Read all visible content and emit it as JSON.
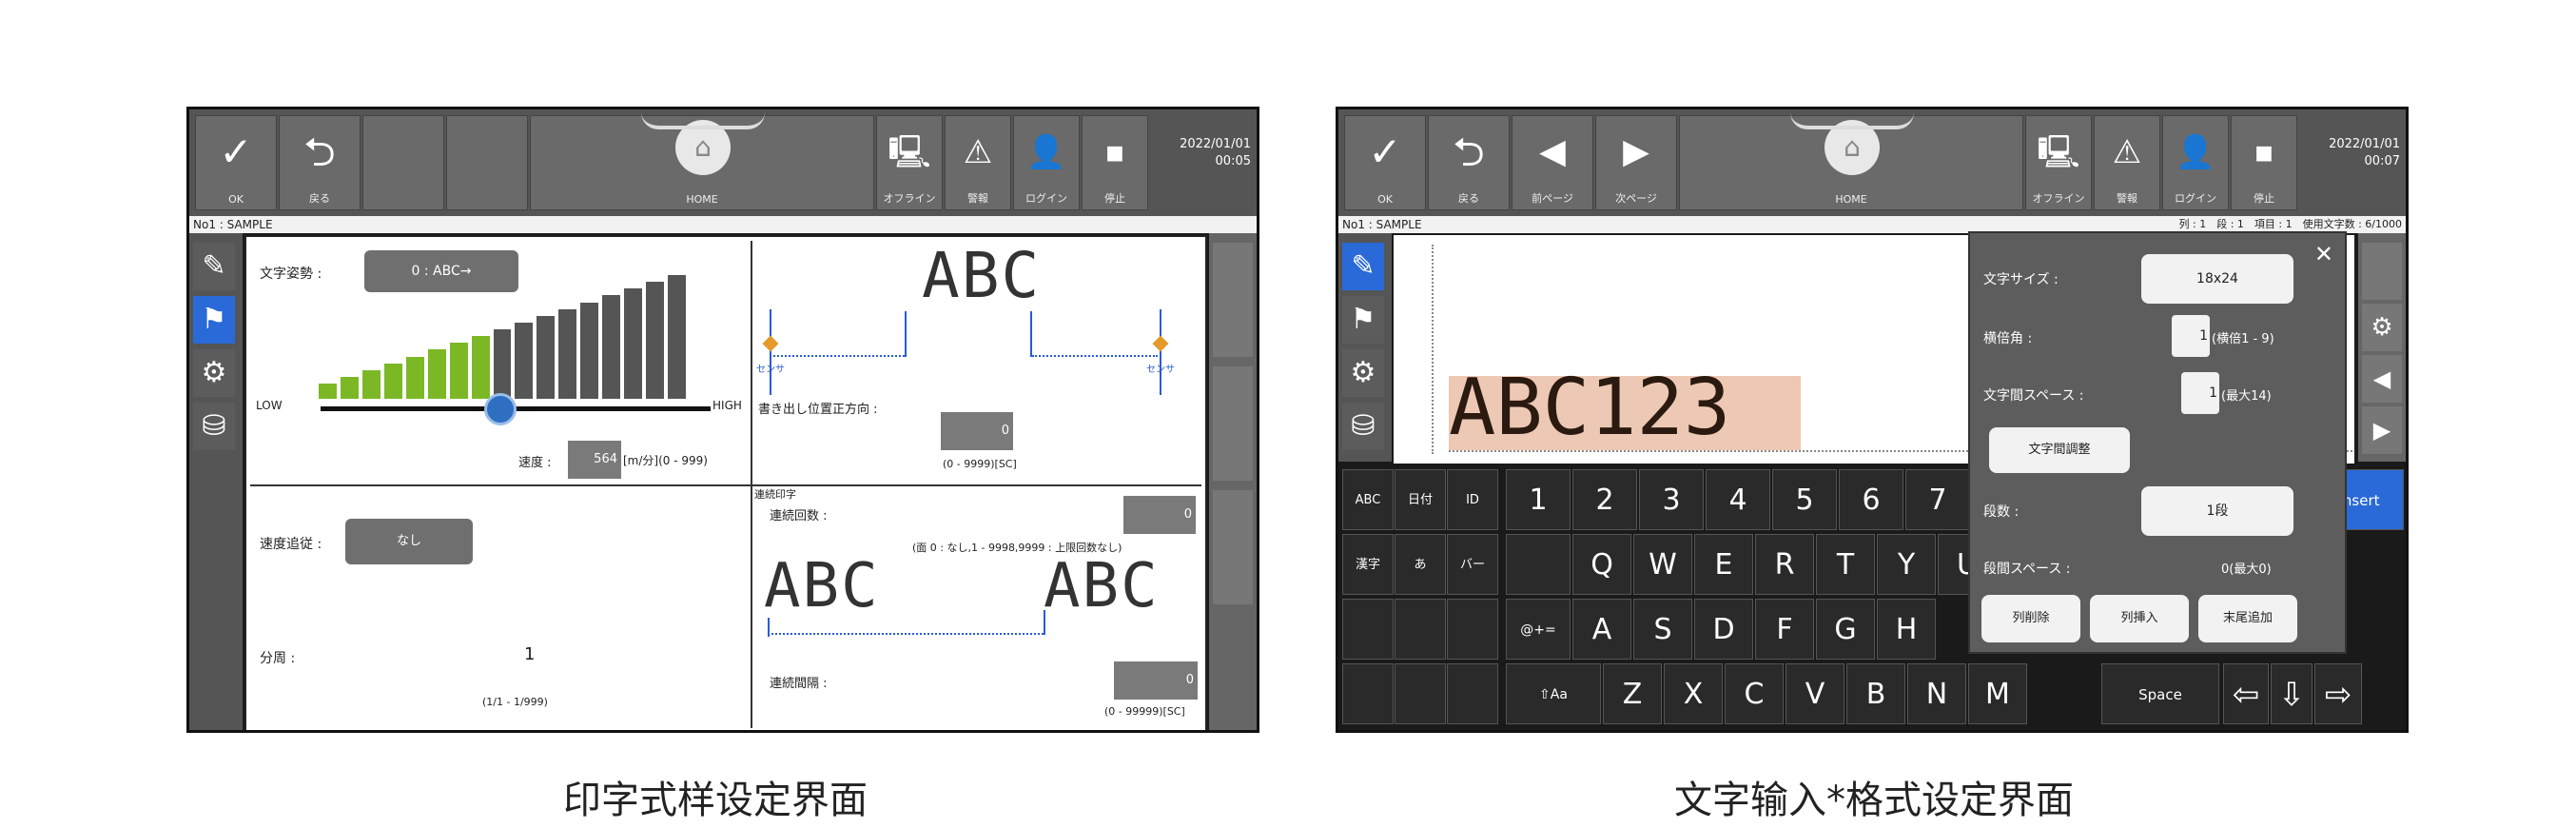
{
  "left_screen": {
    "toolbar": {
      "ok_label": "OK",
      "back_label": "戻る",
      "home_label": "HOME",
      "offline_label": "オフライン",
      "alarm_label": "警報",
      "login_label": "ログイン",
      "stop_label": "停止",
      "date": "2022/01/01",
      "time": "00:05"
    },
    "file_name": "No1 : SAMPLE",
    "print_settings": {
      "char_direction_label": "文字姿勢 :",
      "char_direction_value": "0 : ABC→",
      "low_label": "LOW",
      "high_label": "HIGH",
      "level_bars": 17,
      "green_bars": 8,
      "speed_label": "速度 :",
      "speed_value": "564",
      "speed_unit": "[m/分](0 - 999)",
      "preview_text": "ABC",
      "sensor_label": "センサ",
      "print_start_label": "書き出し位置正方向 :",
      "print_start_value": "0",
      "print_start_range": "(0 - 9999)[SC]",
      "speed_follow_label": "速度追従 :",
      "speed_follow_value": "なし",
      "continuous_title": "連続印字",
      "continuous_count_label": "連続回数 :",
      "continuous_count_value": "0",
      "continuous_note": "(面 0 : なし,1 - 9998,9999 : 上限回数なし)",
      "continuous_preview": "ABC",
      "continuous_interval_label": "連続間隔 :",
      "continuous_interval_value": "0",
      "continuous_interval_range": "(0 - 99999)[SC]",
      "division_label": "分周 :",
      "division_value": "1",
      "division_range": "(1/1 - 1/999)"
    },
    "caption": "印字式样设定界面"
  },
  "right_screen": {
    "toolbar": {
      "ok_label": "OK",
      "back_label": "戻る",
      "prev_label": "前ページ",
      "next_label": "次ページ",
      "home_label": "HOME",
      "offline_label": "オフライン",
      "alarm_label": "警報",
      "login_label": "ログイン",
      "stop_label": "停止",
      "date": "2022/01/01",
      "time": "00:07"
    },
    "file_name": "No1 : SAMPLE",
    "status": "列 : 1　段 : 1　項目 : 1　使用文字数 : 6/1000",
    "edit_text": "ABC123",
    "popup": {
      "size_label": "文字サイズ :",
      "size_value": "18x24",
      "width_label": "横倍角 :",
      "width_value": "1",
      "width_range": "(横倍1 - 9)",
      "spacing_label": "文字間スペース :",
      "spacing_value": "1",
      "spacing_range": "(最大14)",
      "spacing_adjust_button": "文字間調整",
      "rows_label": "段数 :",
      "rows_value": "1段",
      "row_space_label": "段間スペース :",
      "row_space_value": "0(最大0)",
      "delete_col_button": "列削除",
      "insert_col_button": "列挿入",
      "append_button": "末尾追加",
      "close_symbol": "✕"
    },
    "keyboard": {
      "func_keys": [
        "ABC",
        "日付",
        "ID",
        "漢字",
        "あ",
        "バー"
      ],
      "row1": [
        "1",
        "2",
        "3",
        "4",
        "5",
        "6",
        "7"
      ],
      "row2": [
        "Q",
        "W",
        "E",
        "R",
        "T",
        "Y",
        "U"
      ],
      "row3": [
        "A",
        "S",
        "D",
        "F",
        "G",
        "H"
      ],
      "row4": [
        "Z",
        "X",
        "C",
        "V",
        "B",
        "N",
        "M"
      ],
      "sym_key": "@+=",
      "shift_key": "⇧Aa",
      "space_key": "Space",
      "insert_key": "Insert",
      "left_arrow": "⇦",
      "down_arrow": "⇩",
      "right_arrow": "⇨"
    },
    "caption": "文字输入*格式设定界面"
  }
}
